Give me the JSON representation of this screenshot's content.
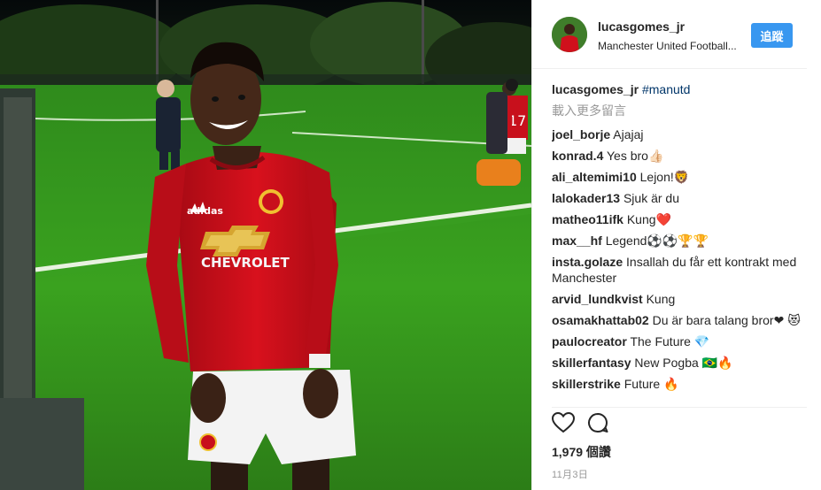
{
  "post": {
    "username": "lucasgomes_jr",
    "location": "Manchester United Football...",
    "follow_label": "追蹤",
    "caption_user": "lucasgomes_jr",
    "caption_tag": "#manutd",
    "load_more": "載入更多留言",
    "likes": "1,979 個讚",
    "date": "11月3日"
  },
  "photo": {
    "jersey_sponsor": "CHEVROLET",
    "jersey_brand": "adidas"
  },
  "comments": [
    {
      "user": "joel_borje",
      "text": "Ajajaj"
    },
    {
      "user": "konrad.4",
      "text": "Yes bro👍🏻"
    },
    {
      "user": "ali_altemimi10",
      "text": "Lejon!🦁"
    },
    {
      "user": "lalokader13",
      "text": "Sjuk är du"
    },
    {
      "user": "matheo11ifk",
      "text": "Kung❤️"
    },
    {
      "user": "max__hf",
      "text": "Legend⚽⚽🏆🏆"
    },
    {
      "user": "insta.golaze",
      "text": "Insallah du får ett kontrakt med Manchester"
    },
    {
      "user": "arvid_lundkvist",
      "text": "Kung"
    },
    {
      "user": "osamakhattab02",
      "text": "Du är bara talang bror❤ 😻"
    },
    {
      "user": "paulocreator",
      "text": "The Future 💎"
    },
    {
      "user": "skillerfantasy",
      "text": "New Pogba 🇧🇷🔥"
    },
    {
      "user": "skillerstrike",
      "text": "Future 🔥"
    }
  ],
  "colors": {
    "accent": "#3897f0",
    "hashtag": "#003569",
    "muted": "#999999",
    "jersey_red": "#d0101c"
  },
  "icons": [
    "heart-icon",
    "comment-icon"
  ]
}
